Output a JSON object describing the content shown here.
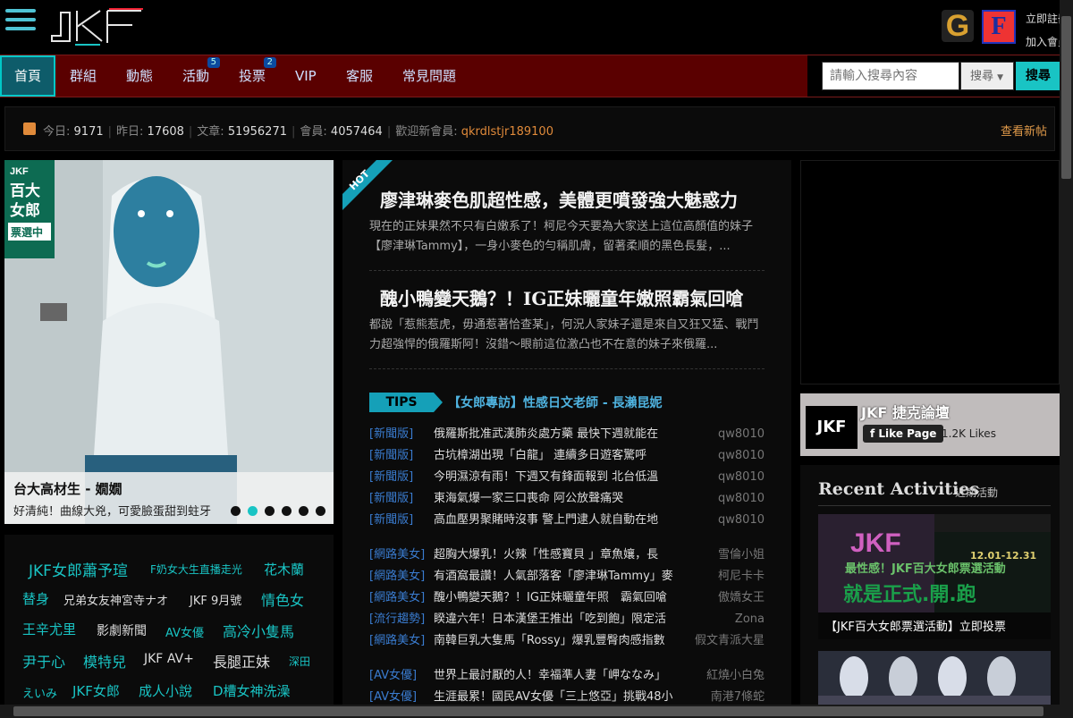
{
  "header": {
    "logo_text": "JKF",
    "google_label": "G",
    "facebook_label": "F",
    "register": "立即註冊",
    "login": "加入會員"
  },
  "nav": {
    "items": [
      {
        "label": "首頁",
        "badge": ""
      },
      {
        "label": "群組",
        "badge": ""
      },
      {
        "label": "動態",
        "badge": ""
      },
      {
        "label": "活動",
        "badge": "5"
      },
      {
        "label": "投票",
        "badge": "2"
      },
      {
        "label": "VIP",
        "badge": ""
      },
      {
        "label": "客服",
        "badge": ""
      },
      {
        "label": "常見問題",
        "badge": ""
      }
    ],
    "search": {
      "placeholder": "請輸入搜尋內容",
      "select": "搜尋",
      "button": "搜尋"
    }
  },
  "stats": {
    "today_label": "今日:",
    "today": "9171",
    "yesterday_label": "昨日:",
    "yesterday": "17608",
    "posts_label": "文章:",
    "posts": "51956271",
    "members_label": "會員:",
    "members": "4057464",
    "welcome_label": "歡迎新會員:",
    "welcome": "qkrdlstjr189100",
    "more": "查看新帖"
  },
  "carousel": {
    "badge": "JKF百大女郎票選中",
    "title": "台大高材生 - 嫺嫺",
    "subtitle": "好清純！曲線大兇，可愛臉蛋甜到蛀牙",
    "slide_count": 6,
    "active": 1
  },
  "tags": [
    "JKF女郎蕭予瑄",
    "F奶女大生直播走光",
    "花木蘭",
    "替身",
    "兄弟女友神宮寺ナオ",
    "JKF 9月號",
    "情色女",
    "王辛尤里",
    "影劇新聞",
    "AV女優",
    "高冷小隻馬",
    "尹于心",
    "模特兒",
    "JKF AV+",
    "長腿正妹",
    "深田",
    "えいみ",
    "JKF女郎",
    "成人小說",
    "D槽女神洗澡"
  ],
  "feed": {
    "hot": "HOT",
    "articles": [
      {
        "title": "廖津琳麥色肌超性感，美體更噴發強大魅惑力",
        "excerpt": "現在的正妹果然不只有白嫩系了！柯尼今天要為大家送上這位高顏值的妹子【廖津琳Tammy】，一身小麥色的勻稱肌膚，留著柔順的黑色長髮，..."
      },
      {
        "title": "醜小鴨變天鵝？！IG正妹曬童年嫩照霸氣回嗆",
        "excerpt": "都說「惹熊惹虎，毋通惹著恰查某」，何況人家妹子還是來自又狂又猛、戰鬥力超強悍的俄羅斯阿！沒錯～眼前這位激凸也不在意的妹子來俄羅..."
      }
    ],
    "tips_label": "TIPS",
    "tips_link": "【女郎專訪】性感日文老師 - 長瀨昆妮",
    "rows": [
      {
        "cat": "[新聞版]",
        "title": "俄羅斯批准武漢肺炎處方藥 最快下週就能在",
        "author": "qw8010"
      },
      {
        "cat": "[新聞版]",
        "title": "古坑樟湖出現「白龍」 連續多日遊客驚呼",
        "author": "qw8010"
      },
      {
        "cat": "[新聞版]",
        "title": "今明濕涼有雨！下週又有鋒面報到 北台低溫",
        "author": "qw8010"
      },
      {
        "cat": "[新聞版]",
        "title": "東海氣爆一家三口喪命 阿公放聲痛哭",
        "author": "qw8010"
      },
      {
        "cat": "[新聞版]",
        "title": "高血壓男聚賭時沒事 警上門逮人就自動在地",
        "author": "qw8010"
      },
      {
        "cat": "[網路美女]",
        "title": "超胸大爆乳！火辣「性感寶貝 」章魚孃，長",
        "author": "雪倫小姐"
      },
      {
        "cat": "[網路美女]",
        "title": "有酒窩最讚！人氣部落客「廖津琳Tammy」麥",
        "author": "柯尼卡卡"
      },
      {
        "cat": "[網路美女]",
        "title": "醜小鴨變天鵝？！IG正妹曬童年照　霸氣回嗆",
        "author": "傲嬌女王"
      },
      {
        "cat": "[流行趨勢]",
        "title": "睽違六年！日本漢堡王推出「吃到飽」限定活",
        "author": "Zona"
      },
      {
        "cat": "[網路美女]",
        "title": "南韓巨乳大隻馬「Rossy」爆乳豐臀肉感指數",
        "author": "假文青派大星"
      },
      {
        "cat": "[AV女優]",
        "title": "世界上最討厭的人！幸福準人妻「岬ななみ」",
        "author": "紅燒小白兔"
      },
      {
        "cat": "[AV女優]",
        "title": "生涯最累！國民AV女優「三上悠亞」挑戰48小",
        "author": "南港7條蛇"
      }
    ]
  },
  "fbpage": {
    "logo": "JKF",
    "name": "JKF 捷克論壇",
    "like": "Like Page",
    "count": "1.2K Likes"
  },
  "recent": {
    "title": "Recent Activities",
    "subtitle": "近期活動",
    "promo1_date": "12.01-12.31",
    "promo1_line2": "最性感！JKF百大女郎票選活動",
    "promo1_line3": "就是正式.開.跑",
    "promo1_caption": "【JKF百大女郎票選活動】立即投票"
  },
  "colors": {
    "accent": "#19c4c4",
    "nav_bg": "#5a0000",
    "link": "#3a7cd0",
    "stats_accent": "#e08a3a"
  }
}
